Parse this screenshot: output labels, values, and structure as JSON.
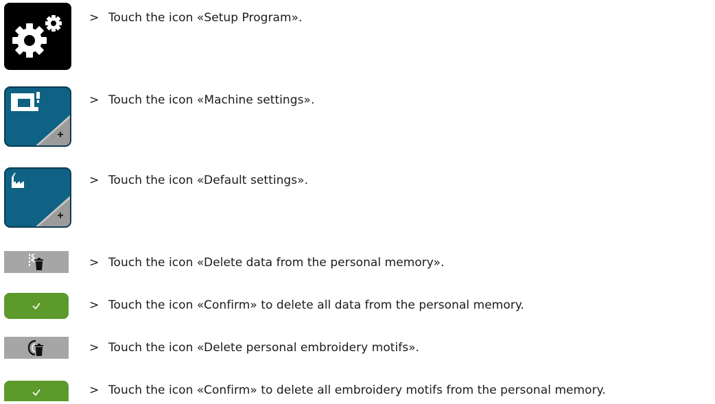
{
  "steps": [
    {
      "marker": ">",
      "text": "Touch the icon «Setup Program».",
      "icon": "setup-program-icon"
    },
    {
      "marker": ">",
      "text": "Touch the icon «Machine settings».",
      "icon": "machine-settings-icon"
    },
    {
      "marker": ">",
      "text": "Touch the icon «Default settings».",
      "icon": "default-settings-icon"
    },
    {
      "marker": ">",
      "text": "Touch the icon «Delete data from the personal memory».",
      "icon": "delete-personal-memory-icon"
    },
    {
      "marker": ">",
      "text": "Touch the icon «Confirm» to delete all data from the personal memory.",
      "icon": "confirm-checkmark-icon"
    },
    {
      "marker": ">",
      "text": "Touch the icon «Delete personal embroidery motifs».",
      "icon": "delete-embroidery-motifs-icon"
    },
    {
      "marker": ">",
      "text": "Touch the icon «Confirm» to delete all embroidery motifs from the personal memory.",
      "icon": "confirm-checkmark-icon"
    }
  ],
  "colors": {
    "setup_bg": "#000000",
    "blue_tile": "#0f6283",
    "grey_button": "#a6a6a6",
    "green_button": "#5c9a2b",
    "icon_white": "#ffffff"
  }
}
